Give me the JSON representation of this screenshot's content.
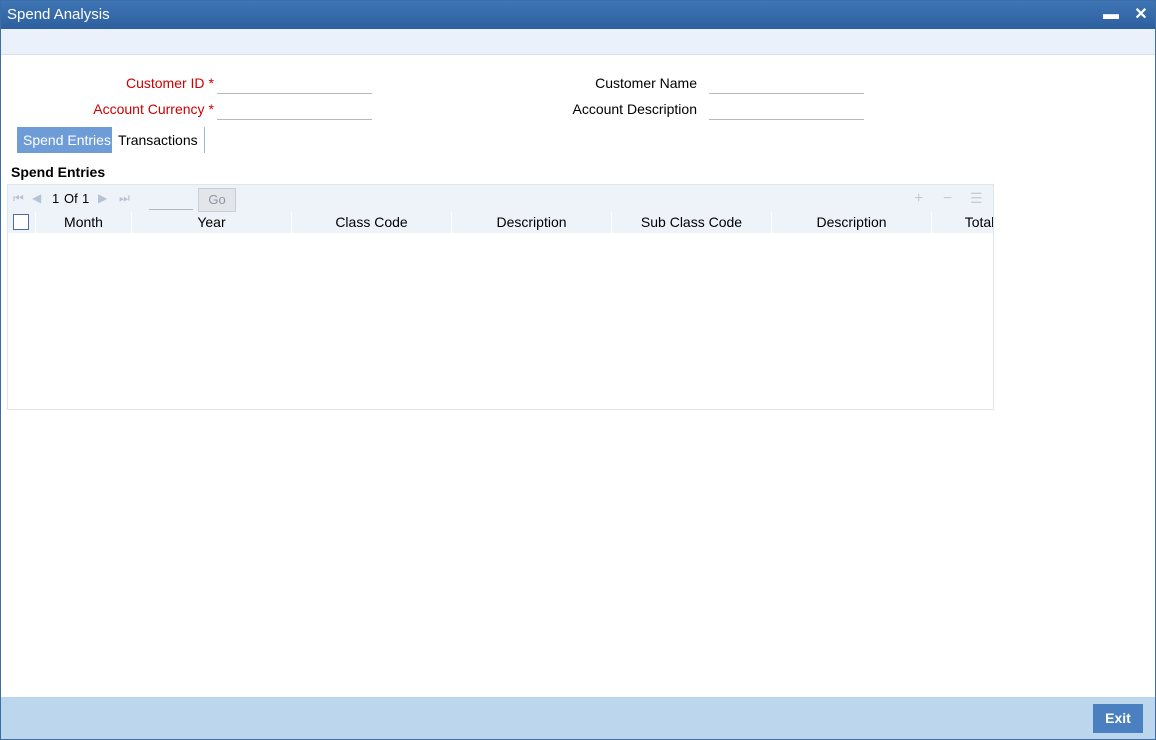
{
  "window": {
    "title": "Spend Analysis",
    "minimize_glyph": "▬",
    "close_glyph": "✕"
  },
  "form": {
    "customer_id": {
      "label": "Customer ID",
      "value": ""
    },
    "account_currency": {
      "label": "Account Currency",
      "value": ""
    },
    "customer_name": {
      "label": "Customer Name",
      "value": ""
    },
    "account_description": {
      "label": "Account Description",
      "value": ""
    },
    "required_marker": "*"
  },
  "tabs": [
    {
      "label": "Spend Entries",
      "active": true
    },
    {
      "label": "Transactions",
      "active": false
    }
  ],
  "section": {
    "title": "Spend Entries"
  },
  "pager": {
    "current": "1",
    "of_label": "Of",
    "total": "1",
    "go_label": "Go",
    "page_input": ""
  },
  "grid": {
    "columns": [
      "Month",
      "Year",
      "Class Code",
      "Description",
      "Sub Class Code",
      "Description",
      "Total"
    ],
    "rows": []
  },
  "footer": {
    "exit_label": "Exit"
  },
  "colors": {
    "titlebar": "#2d5f9e",
    "active_tab": "#6e9cd6",
    "required": "#cc0000",
    "footer": "#bcd6ee",
    "exit_button": "#4a80bf"
  },
  "icons": [
    "first-page-icon",
    "prev-page-icon",
    "next-page-icon",
    "last-page-icon",
    "add-row-icon",
    "delete-row-icon",
    "single-view-icon",
    "minimize-icon",
    "close-icon"
  ]
}
